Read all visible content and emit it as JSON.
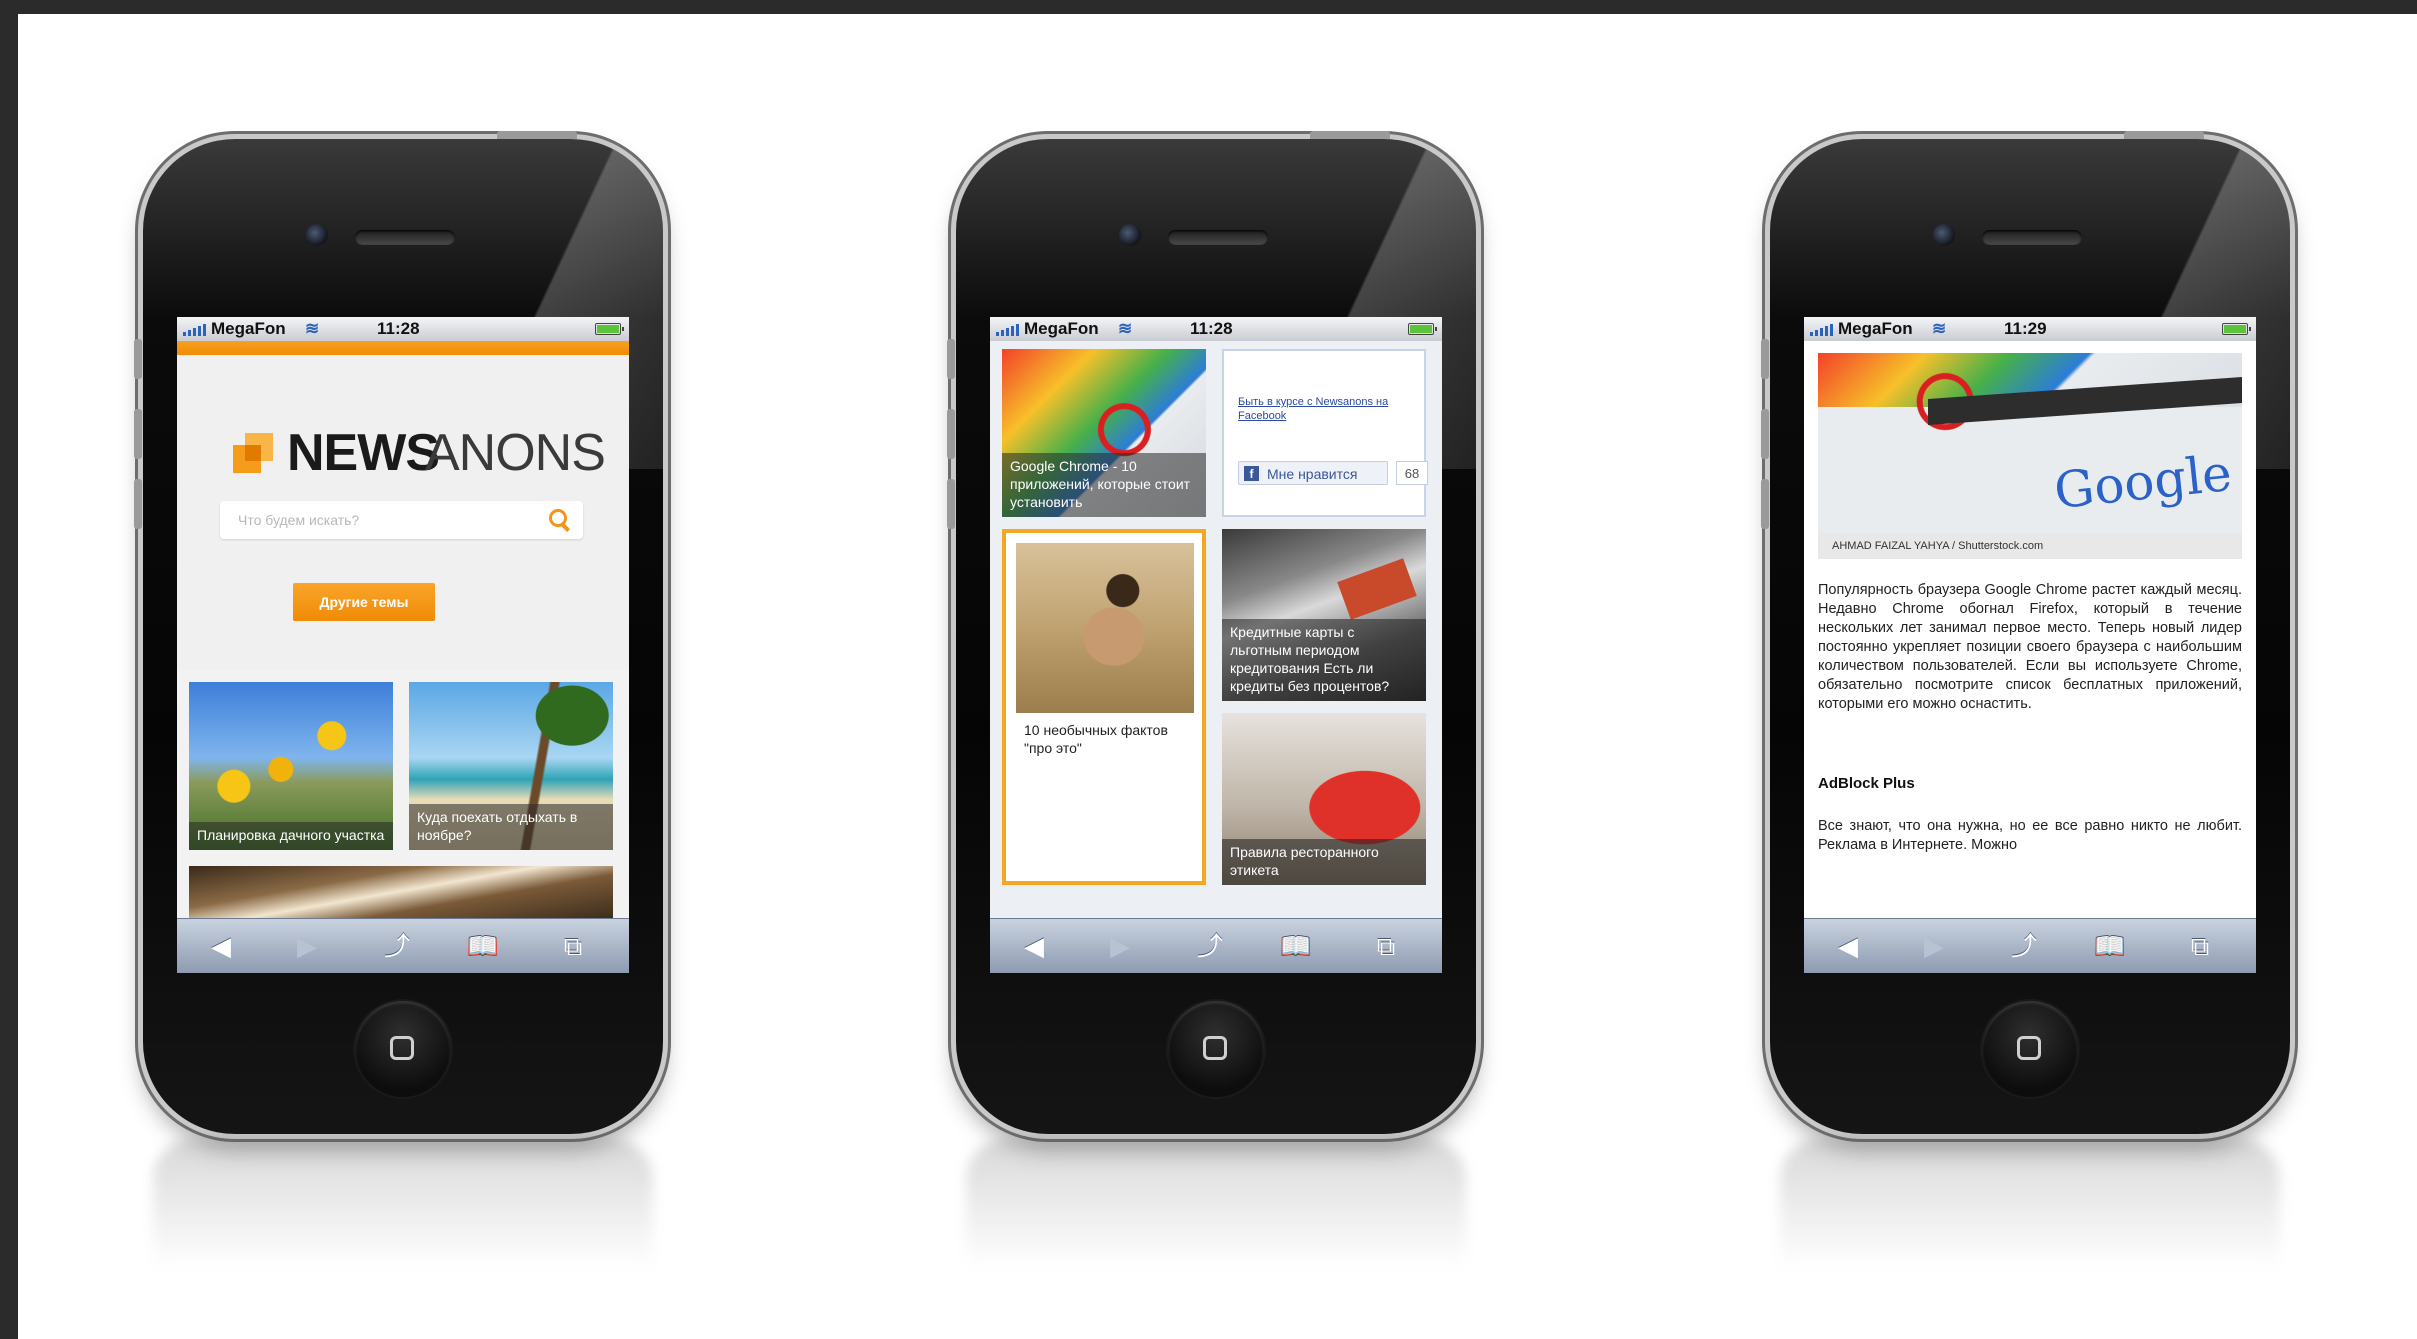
{
  "status": {
    "carrier": "MegaFon",
    "time_phone1": "11:28",
    "time_phone2": "11:28",
    "time_phone3": "11:29"
  },
  "phone1": {
    "logo_news": "NEWS",
    "logo_anons": "ANONS",
    "search_placeholder": "Что будем искать?",
    "topics_button": "Другие темы",
    "tiles": [
      {
        "caption": "Планировка дачного участка"
      },
      {
        "caption": "Куда поехать отдыхать в ноябре?"
      }
    ]
  },
  "phone2": {
    "tiles": [
      {
        "caption": "Google Chrome - 10 приложений, которые стоит установить"
      },
      {
        "caption": "10 необычных фактов \"про это\""
      },
      {
        "caption": "Кредитные карты с льготным периодом кредитования Есть ли кредиты без процентов?"
      },
      {
        "caption": "Правила ресторанного этикета"
      }
    ],
    "facebook": {
      "link_text": "Быть в курсе с Newsanons на Facebook",
      "like_label": "Мне нравится",
      "like_count": "68"
    }
  },
  "phone3": {
    "image_word": "Google",
    "image_credit": "AHMAD FAIZAL YAHYA / Shutterstock.com",
    "paragraph1": "Популярность браузера Google Chrome растет каждый месяц. Недавно Chrome обогнал Firefox, который в течение нескольких лет занимал первое место. Теперь новый лидер постоянно укрепляет позиции своего браузера с наибольшим количеством пользователей. Если вы используете Chrome, обязательно посмотрите список бесплатных приложений, которыми его можно оснастить.",
    "heading": "AdBlock Plus",
    "paragraph2": "Все знают, что она нужна, но ее все равно никто не любит. Реклама в Интернете. Можно"
  },
  "toolbar": {
    "back_icon": "◀",
    "forward_icon": "▶",
    "share_icon": "⤴",
    "bookmarks_icon": "📖",
    "tabs_icon": "⧉"
  },
  "colors": {
    "accent_orange": "#f5941a",
    "facebook_blue": "#3b5998",
    "toolbar_blue": "#8d9bb1"
  }
}
